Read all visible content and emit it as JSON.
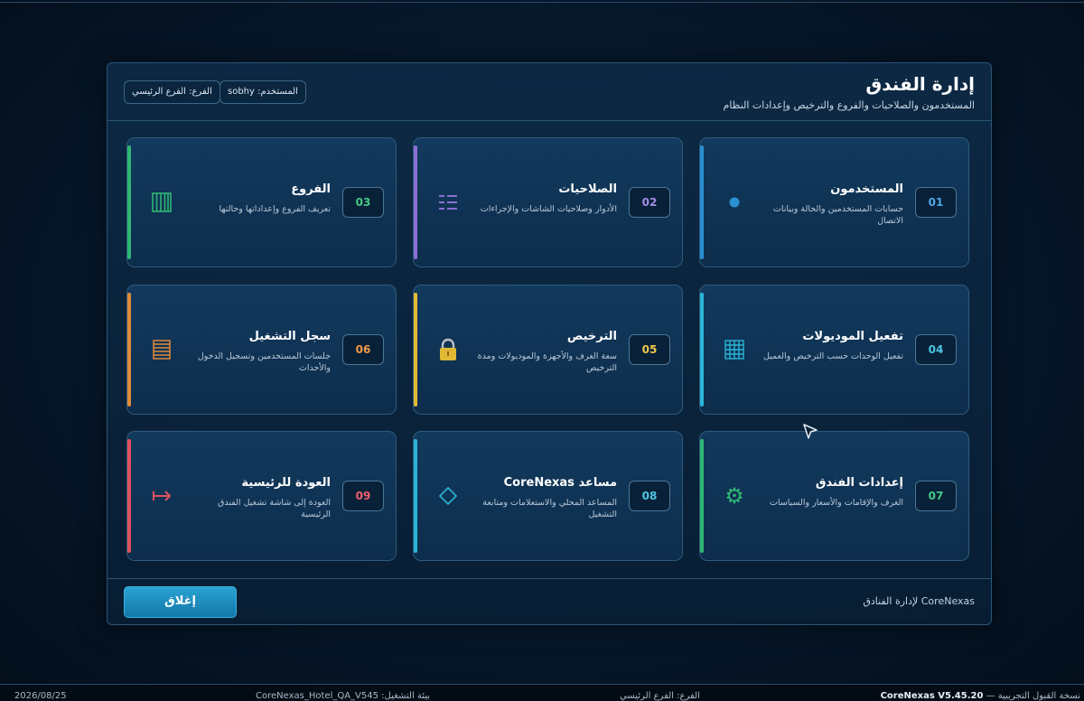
{
  "window": {
    "title": "إدارة الفندق",
    "subtitle": "المستخدمون والصلاحيات والفروع والترخيص وإعدادات النظام",
    "user_chip": "المستخدم: sobhy",
    "branch_chip": "الفرع: الفرع الرئيسي"
  },
  "cards": [
    {
      "num": "01",
      "title": "المستخدمون",
      "desc": "حسابات المستخدمين والحالة وبيانات الاتصال",
      "icon": "user-dot-icon",
      "color": "#2b8fd0"
    },
    {
      "num": "02",
      "title": "الصلاحيات",
      "desc": "الأدوار وصلاحيات الشاشات والإجراءات",
      "icon": "permissions-list-icon",
      "color": "#8a6fd4"
    },
    {
      "num": "03",
      "title": "الفروع",
      "desc": "تعريف الفروع وإعداداتها وحالتها",
      "icon": "branches-icon",
      "color": "#2fb673"
    },
    {
      "num": "04",
      "title": "تفعيل الموديولات",
      "desc": "تفعيل الوحدات حسب الترخيص والعميل",
      "icon": "modules-grid-icon",
      "color": "#2ab5d6"
    },
    {
      "num": "05",
      "title": "الترخيص",
      "desc": "سعة الغرف والأجهزة والموديولات ومدة الترخيص",
      "icon": "lock-icon",
      "color": "#e2b935"
    },
    {
      "num": "06",
      "title": "سجل التشغيل",
      "desc": "جلسات المستخدمين وتسجيل الدخول والأحداث",
      "icon": "log-icon",
      "color": "#e08a3a"
    },
    {
      "num": "07",
      "title": "إعدادات الفندق",
      "desc": "الغرف والإقامات والأسعار والسياسات",
      "icon": "gear-icon",
      "color": "#2fb673"
    },
    {
      "num": "08",
      "title": "مساعد CoreNexas",
      "desc": "المساعد المحلي والاستعلامات ومتابعة التشغيل",
      "icon": "assistant-diamond-icon",
      "color": "#2ab5d6"
    },
    {
      "num": "09",
      "title": "العودة للرئيسية",
      "desc": "العودة إلى شاشة تشغيل الفندق الرئيسية",
      "icon": "back-arrow-icon",
      "color": "#e0505e"
    }
  ],
  "footer": {
    "brand_text": "CoreNexas لإدارة الفنادق",
    "close_label": "إغلاق"
  },
  "statusbar": {
    "date": "2026/08/25",
    "env": "بيئة التشغيل: CoreNexas_Hotel_QA_V545",
    "branch": "الفرع: الفرع الرئيسي",
    "version_prefix": "نسخة القبول التجريبية — ",
    "version": "CoreNexas V5.45.20"
  }
}
